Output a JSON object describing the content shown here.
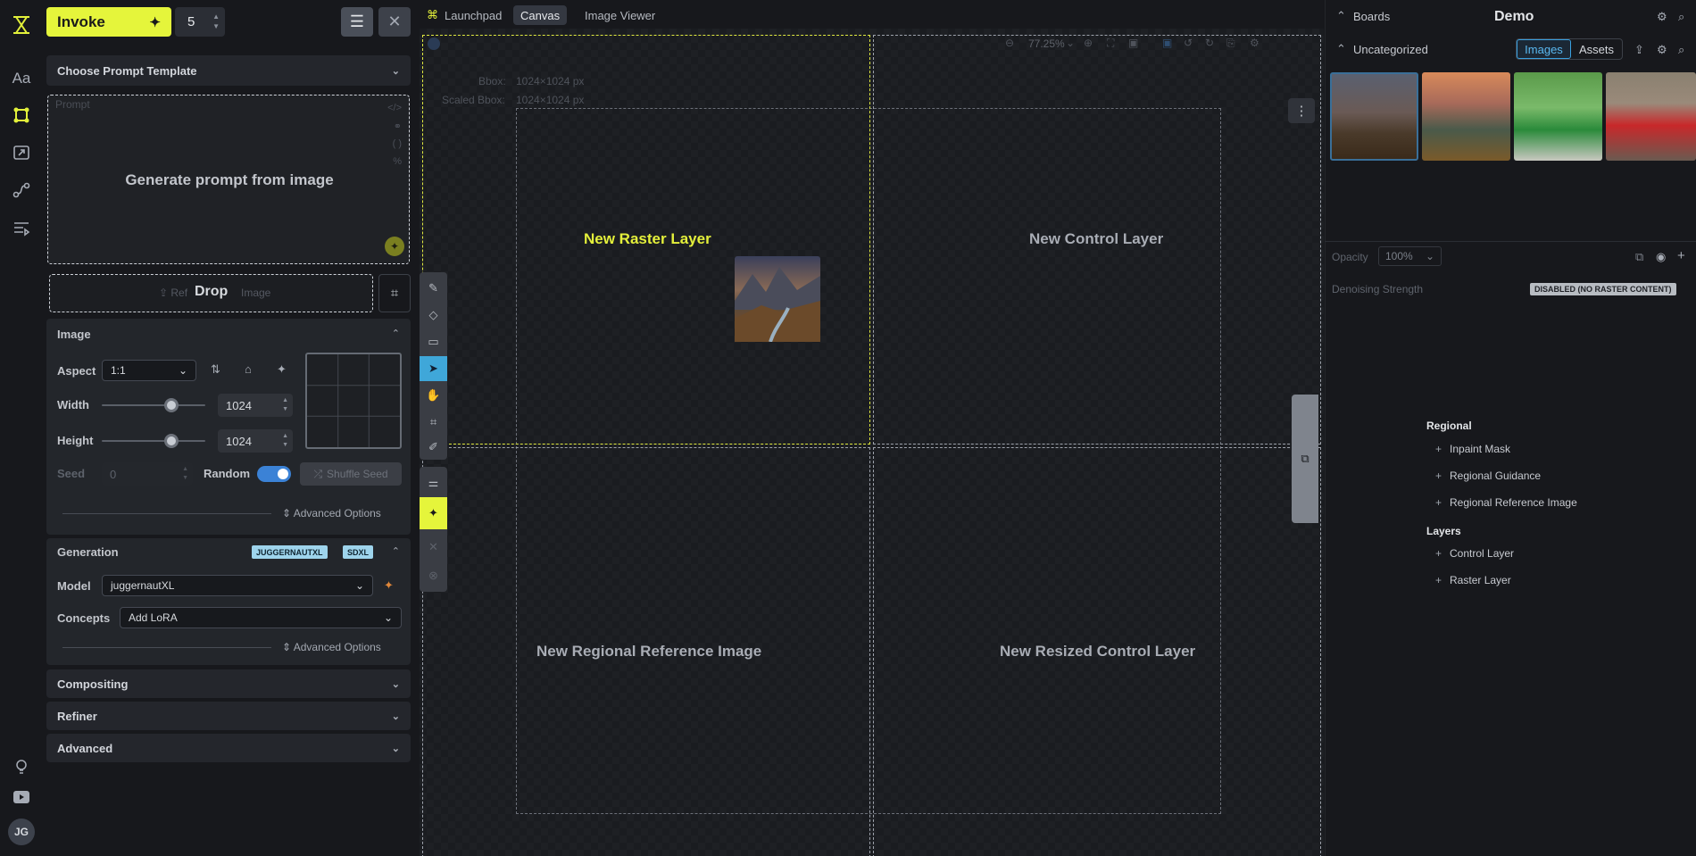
{
  "app": {
    "logo_icon": "invoke-logo-icon"
  },
  "rail": {
    "items": [
      {
        "name": "text-icon",
        "glyph": "Aa"
      },
      {
        "name": "canvas-icon",
        "glyph": "⌘"
      },
      {
        "name": "upscale-icon",
        "glyph": "⤢"
      },
      {
        "name": "workflows-icon",
        "glyph": "⟿"
      },
      {
        "name": "queue-icon",
        "glyph": "☰"
      }
    ],
    "bottom": [
      {
        "name": "lightbulb-icon",
        "glyph": "💡"
      },
      {
        "name": "youtube-icon",
        "glyph": "▶"
      }
    ],
    "avatar": "JG"
  },
  "toolbar": {
    "invoke_label": "Invoke",
    "iterations": "5"
  },
  "prompt_template": {
    "label": "Choose Prompt Template"
  },
  "prompt": {
    "placeholder": "Prompt",
    "overlay": "Generate prompt from image"
  },
  "ref_image": {
    "faint": "Ref",
    "drop": "Drop",
    "faint2": "Image"
  },
  "image_panel": {
    "title": "Image",
    "aspect_label": "Aspect",
    "aspect_value": "1:1",
    "width_label": "Width",
    "width_value": "1024",
    "width_level": 0.67,
    "height_label": "Height",
    "height_value": "1024",
    "height_level": 0.67,
    "seed_label": "Seed",
    "seed_value": "0",
    "random_label": "Random",
    "shuffle_label": "Shuffle Seed",
    "advanced_label": "Advanced Options"
  },
  "generation_panel": {
    "title": "Generation",
    "badges": [
      "JUGGERNAUTXL",
      "SDXL"
    ],
    "model_label": "Model",
    "model_value": "juggernautXL",
    "concepts_label": "Concepts",
    "concepts_value": "Add LoRA",
    "advanced_label": "Advanced Options"
  },
  "collapsed_sections": [
    "Compositing",
    "Refiner",
    "Advanced"
  ],
  "tabs": [
    {
      "label": "Launchpad",
      "active": false
    },
    {
      "label": "Canvas",
      "active": true
    },
    {
      "label": "Image Viewer",
      "active": false
    }
  ],
  "canvas": {
    "zoom": "77.25%",
    "bbox_label": "Bbox:",
    "bbox_value": "1024×1024 px",
    "scaled_bbox_label": "Scaled Bbox:",
    "scaled_bbox_value": "1024×1024 px",
    "zones": [
      "New Raster Layer",
      "New Control Layer",
      "New Regional Reference Image",
      "New Resized Control Layer"
    ]
  },
  "boards": {
    "title": "Boards",
    "board_name": "Demo",
    "category": "Uncategorized",
    "images_tab": "Images",
    "assets_tab": "Assets"
  },
  "layers": {
    "opacity_label": "Opacity",
    "opacity_value": "100%",
    "denoise_label": "Denoising Strength",
    "denoise_badge": "DISABLED (NO RASTER CONTENT)",
    "regional_heading": "Regional",
    "regional_items": [
      "Inpaint Mask",
      "Regional Guidance",
      "Regional Reference Image"
    ],
    "layers_heading": "Layers",
    "layer_items": [
      "Control Layer",
      "Raster Layer"
    ]
  },
  "colors": {
    "accent": "#e5f53b",
    "selection": "#3fa7d9"
  }
}
